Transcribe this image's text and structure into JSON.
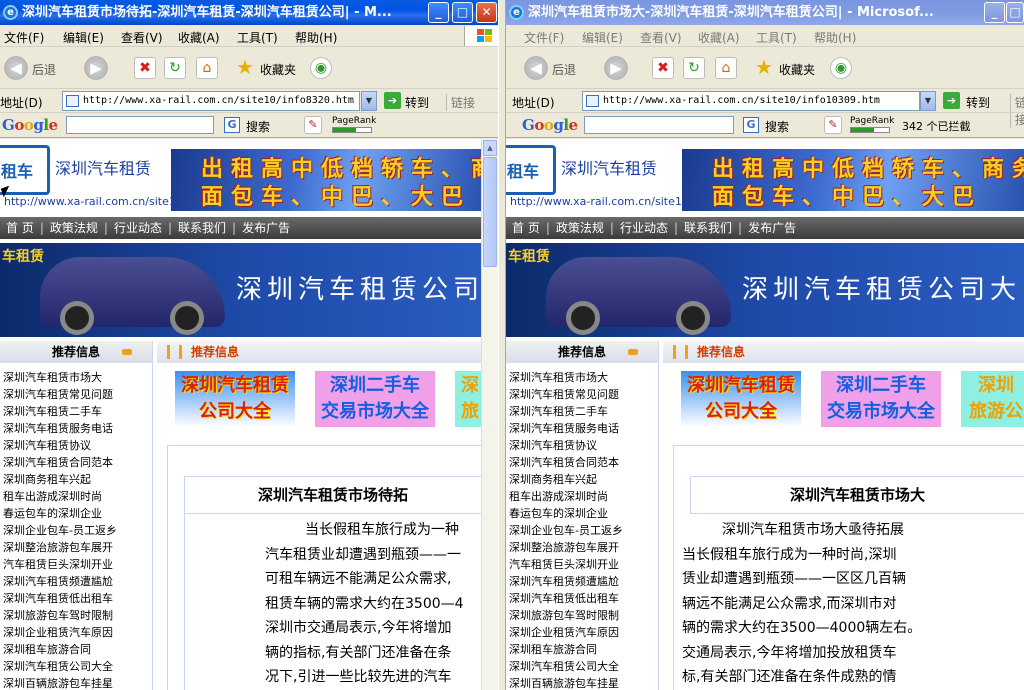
{
  "left": {
    "title": "深圳汽车租赁市场待拓-深圳汽车租赁-深圳汽车租赁公司| - M...",
    "menu": [
      "文件(F)",
      "编辑(E)",
      "查看(V)",
      "收藏(A)",
      "工具(T)",
      "帮助(H)"
    ],
    "toolbar": {
      "back": "后退",
      "favorites": "收藏夹"
    },
    "address": {
      "label": "地址(D)",
      "url": "http://www.xa-rail.com.cn/site10/info8320.htm",
      "go": "转到",
      "links": "链接"
    },
    "google": {
      "logo": "Google",
      "search": "搜索",
      "pagerank": "PageRank"
    },
    "site": {
      "logo_char": "租车",
      "name": "深圳汽车租赁",
      "url": "http://www.xa-rail.com.cn/site10/",
      "banner": [
        "出租高中低档轿车、商",
        "面包车、中巴、大巴"
      ],
      "nav": [
        "首 页",
        "政策法规",
        "行业动态",
        "联系我们",
        "发布广告"
      ],
      "big_banner_small": "车租赁",
      "big_banner": "深圳汽车租赁公司",
      "side_head": "推荐信息",
      "main_head": "推荐信息",
      "side_list": [
        "深圳汽车租赁市场大",
        "深圳汽车租赁常见问题",
        "深圳汽车租赁二手车",
        "深圳汽车租赁服务电话",
        "深圳汽车租赁协议",
        "深圳汽车租赁合同范本",
        "深圳商务租车兴起",
        "租车出游成深圳时尚",
        "春运包车的深圳企业",
        "深圳企业包车-员工返乡",
        "深圳整治旅游包车展开",
        "汽车租赁巨头深圳开业",
        "深圳汽车租赁频遭尴尬",
        "深圳汽车租赁低出租车",
        "深圳旅游包车驾时限制",
        "深圳企业租赁汽车原因",
        "深圳租车旅游合同",
        "深圳汽车租赁公司大全",
        "深圳百辆旅游包车挂星"
      ],
      "ads": [
        [
          "深圳汽车租赁",
          "公司大全"
        ],
        [
          "深圳二手车",
          "交易市场大全"
        ],
        [
          "深",
          "旅"
        ]
      ],
      "article_title": "深圳汽车租赁市场待拓",
      "article_lines": [
        "当长假租车旅行成为一种",
        "汽车租赁业却遭遇到瓶颈——一",
        "可租车辆远不能满足公众需求,",
        "租赁车辆的需求大约在3500—4",
        "深圳市交通局表示,今年将增加",
        "辆的指标,有关部门还准备在条",
        "况下,引进一些比较先进的汽车"
      ]
    }
  },
  "right": {
    "title": "深圳汽车租赁市场大-深圳汽车租赁-深圳汽车租赁公司| - Microsof...",
    "menu": [
      "文件(F)",
      "编辑(E)",
      "查看(V)",
      "收藏(A)",
      "工具(T)",
      "帮助(H)"
    ],
    "toolbar": {
      "back": "后退",
      "favorites": "收藏夹"
    },
    "address": {
      "label": "地址(D)",
      "url": "http://www.xa-rail.com.cn/site10/info10309.htm",
      "go": "转到",
      "links": "链接"
    },
    "google": {
      "logo": "Google",
      "search": "搜索",
      "pagerank": "PageRank",
      "blocked": "342 个已拦截"
    },
    "site": {
      "logo_char": "租车",
      "name": "深圳汽车租赁",
      "url": "http://www.xa-rail.com.cn/site10/",
      "banner": [
        "出租高中低档轿车、商务",
        "面包车、中巴、大巴"
      ],
      "nav": [
        "首 页",
        "政策法规",
        "行业动态",
        "联系我们",
        "发布广告"
      ],
      "big_banner_small": "车租赁",
      "big_banner": "深圳汽车租赁公司大",
      "side_head": "推荐信息",
      "main_head": "推荐信息",
      "side_list": [
        "深圳汽车租赁市场大",
        "深圳汽车租赁常见问题",
        "深圳汽车租赁二手车",
        "深圳汽车租赁服务电话",
        "深圳汽车租赁协议",
        "深圳汽车租赁合同范本",
        "深圳商务租车兴起",
        "租车出游成深圳时尚",
        "春运包车的深圳企业",
        "深圳企业包车-员工返乡",
        "深圳整治旅游包车展开",
        "汽车租赁巨头深圳开业",
        "深圳汽车租赁频遭尴尬",
        "深圳汽车租赁低出租车",
        "深圳旅游包车驾时限制",
        "深圳企业租赁汽车原因",
        "深圳租车旅游合同",
        "深圳汽车租赁公司大全",
        "深圳百辆旅游包车挂星"
      ],
      "ads": [
        [
          "深圳汽车租赁",
          "公司大全"
        ],
        [
          "深圳二手车",
          "交易市场大全"
        ],
        [
          "深圳",
          "旅游公"
        ]
      ],
      "article_title": "深圳汽车租赁市场大",
      "article_lines": [
        "深圳汽车租赁市场大亟待拓展",
        "当长假租车旅行成为一种时尚,深圳",
        "赁业却遭遇到瓶颈——一区区几百辆",
        "辆远不能满足公众需求,而深圳市对",
        "辆的需求大约在3500—4000辆左右。",
        "交通局表示,今年将增加投放租赁车",
        "标,有关部门还准备在条件成熟的情"
      ]
    }
  },
  "colors": {
    "titlebar_active": "#0054e3",
    "titlebar_inactive": "#7e9be2",
    "close": "#c83418",
    "nav_strip": "#3c3c3c",
    "banner": "#1e4aa8",
    "main_head": "#d04000"
  }
}
